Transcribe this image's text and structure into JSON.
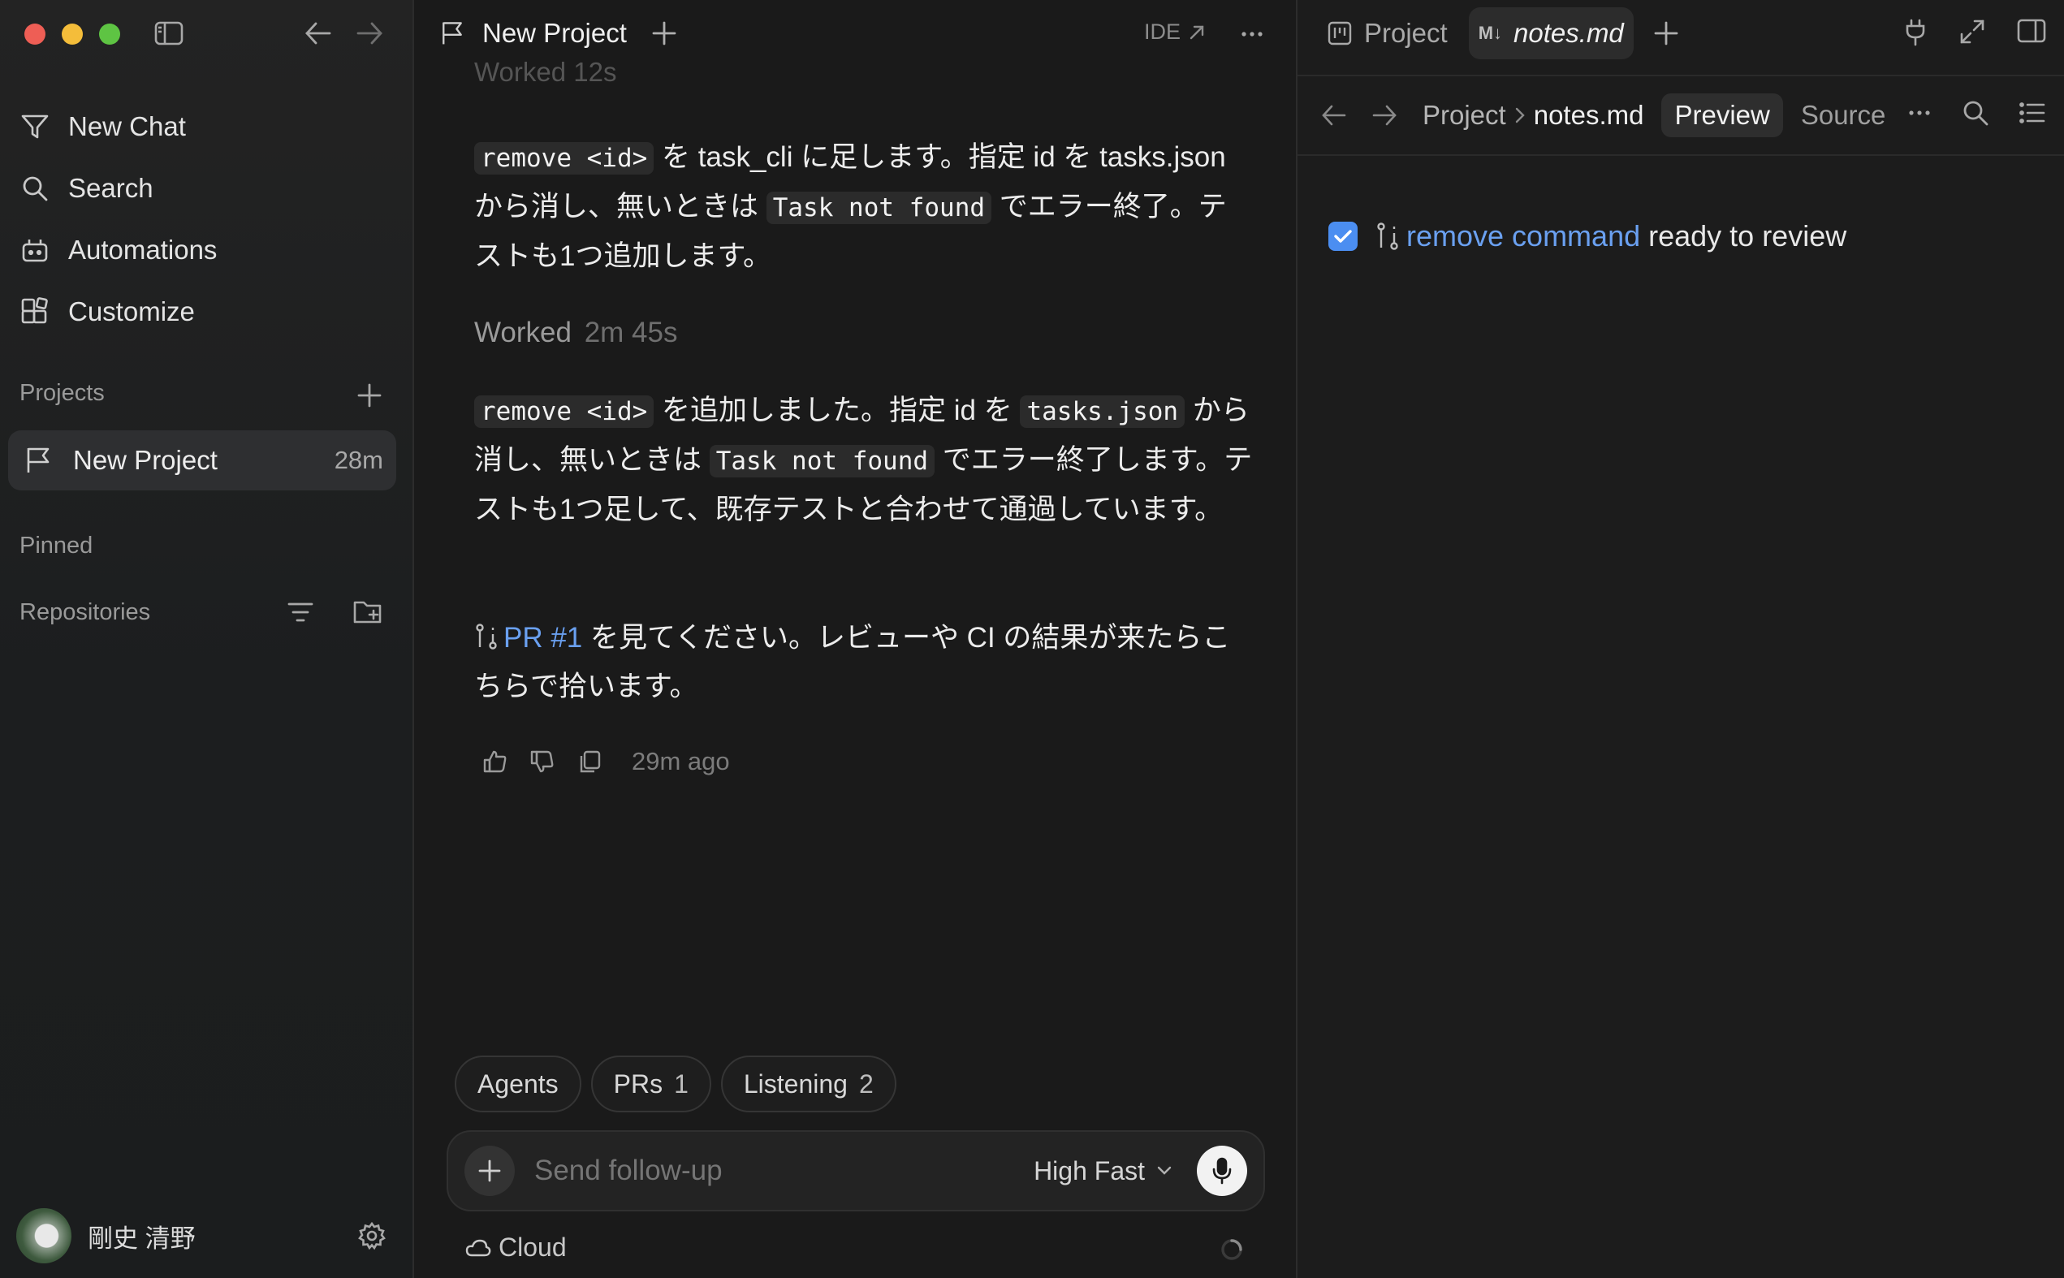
{
  "sidebar": {
    "nav": [
      {
        "label": "New Chat",
        "icon": "new-chat-icon"
      },
      {
        "label": "Search",
        "icon": "search-icon"
      },
      {
        "label": "Automations",
        "icon": "automations-icon"
      },
      {
        "label": "Customize",
        "icon": "customize-icon"
      }
    ],
    "projects_label": "Projects",
    "project": {
      "name": "New Project",
      "age": "28m"
    },
    "pinned_label": "Pinned",
    "repositories_label": "Repositories",
    "user": {
      "name": "剛史 清野"
    }
  },
  "chat": {
    "title": "New Project",
    "ide_label": "IDE",
    "faded_top": "Worked 12s",
    "msg1": {
      "code1": "remove <id>",
      "t1": " を task_cli に足します。指定 id を tasks.json から消し、無いときは ",
      "code2": "Task not found",
      "t2": " でエラー終了。テストも1つ追加します。"
    },
    "worked": {
      "label": "Worked",
      "duration": "2m 45s"
    },
    "msg2": {
      "code1": "remove <id>",
      "t1": " を追加しました。指定 id を ",
      "code2": "tasks.json",
      "t2": " から消し、無いときは ",
      "code3": "Task not found",
      "t3": " でエラー終了します。テストも1つ足して、既存テストと合わせて通過しています。"
    },
    "msg3": {
      "link": "PR #1",
      "text": " を見てください。レビューや CI の結果が来たらこちらで拾います。"
    },
    "time_ago": "29m ago",
    "chips": [
      {
        "label": "Agents",
        "count": ""
      },
      {
        "label": "PRs",
        "count": "1"
      },
      {
        "label": "Listening",
        "count": "2"
      }
    ],
    "composer": {
      "placeholder": "Send follow-up",
      "model": "High Fast"
    },
    "environment": "Cloud"
  },
  "panel": {
    "tabs": [
      {
        "label": "Project",
        "icon": "board-icon"
      },
      {
        "label": "notes.md",
        "icon": "markdown-icon",
        "badge": "M↓"
      }
    ],
    "breadcrumb": [
      "Project",
      "notes.md"
    ],
    "views": [
      "Preview",
      "Source"
    ],
    "active_view": "Preview",
    "task": {
      "checked": true,
      "link": "remove command",
      "text": "ready to review"
    }
  },
  "colors": {
    "accent": "#4b8ef1",
    "link": "#6aa0f0",
    "bg": "#1a1a1a"
  }
}
